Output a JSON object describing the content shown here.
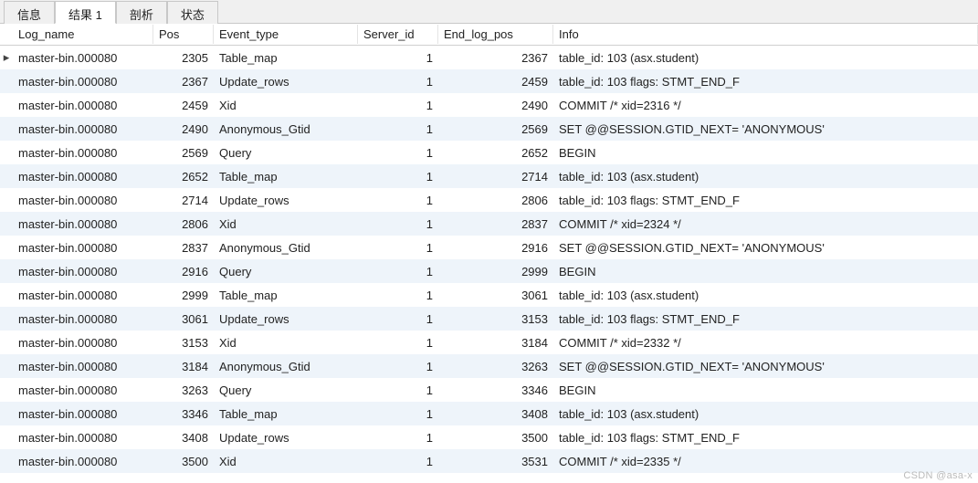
{
  "tabs": {
    "info": "信息",
    "result1": "结果 1",
    "profile": "剖析",
    "status": "状态"
  },
  "columns": {
    "log_name": "Log_name",
    "pos": "Pos",
    "event_type": "Event_type",
    "server_id": "Server_id",
    "end_log_pos": "End_log_pos",
    "info": "Info"
  },
  "rows": [
    {
      "marker": "▸",
      "log_name": "master-bin.000080",
      "pos": "2305",
      "event_type": "Table_map",
      "server_id": "1",
      "end_log_pos": "2367",
      "info": "table_id: 103 (asx.student)"
    },
    {
      "marker": "",
      "log_name": "master-bin.000080",
      "pos": "2367",
      "event_type": "Update_rows",
      "server_id": "1",
      "end_log_pos": "2459",
      "info": "table_id: 103 flags: STMT_END_F"
    },
    {
      "marker": "",
      "log_name": "master-bin.000080",
      "pos": "2459",
      "event_type": "Xid",
      "server_id": "1",
      "end_log_pos": "2490",
      "info": "COMMIT /* xid=2316 */"
    },
    {
      "marker": "",
      "log_name": "master-bin.000080",
      "pos": "2490",
      "event_type": "Anonymous_Gtid",
      "server_id": "1",
      "end_log_pos": "2569",
      "info": "SET @@SESSION.GTID_NEXT= 'ANONYMOUS'"
    },
    {
      "marker": "",
      "log_name": "master-bin.000080",
      "pos": "2569",
      "event_type": "Query",
      "server_id": "1",
      "end_log_pos": "2652",
      "info": "BEGIN"
    },
    {
      "marker": "",
      "log_name": "master-bin.000080",
      "pos": "2652",
      "event_type": "Table_map",
      "server_id": "1",
      "end_log_pos": "2714",
      "info": "table_id: 103 (asx.student)"
    },
    {
      "marker": "",
      "log_name": "master-bin.000080",
      "pos": "2714",
      "event_type": "Update_rows",
      "server_id": "1",
      "end_log_pos": "2806",
      "info": "table_id: 103 flags: STMT_END_F"
    },
    {
      "marker": "",
      "log_name": "master-bin.000080",
      "pos": "2806",
      "event_type": "Xid",
      "server_id": "1",
      "end_log_pos": "2837",
      "info": "COMMIT /* xid=2324 */"
    },
    {
      "marker": "",
      "log_name": "master-bin.000080",
      "pos": "2837",
      "event_type": "Anonymous_Gtid",
      "server_id": "1",
      "end_log_pos": "2916",
      "info": "SET @@SESSION.GTID_NEXT= 'ANONYMOUS'"
    },
    {
      "marker": "",
      "log_name": "master-bin.000080",
      "pos": "2916",
      "event_type": "Query",
      "server_id": "1",
      "end_log_pos": "2999",
      "info": "BEGIN"
    },
    {
      "marker": "",
      "log_name": "master-bin.000080",
      "pos": "2999",
      "event_type": "Table_map",
      "server_id": "1",
      "end_log_pos": "3061",
      "info": "table_id: 103 (asx.student)"
    },
    {
      "marker": "",
      "log_name": "master-bin.000080",
      "pos": "3061",
      "event_type": "Update_rows",
      "server_id": "1",
      "end_log_pos": "3153",
      "info": "table_id: 103 flags: STMT_END_F"
    },
    {
      "marker": "",
      "log_name": "master-bin.000080",
      "pos": "3153",
      "event_type": "Xid",
      "server_id": "1",
      "end_log_pos": "3184",
      "info": "COMMIT /* xid=2332 */"
    },
    {
      "marker": "",
      "log_name": "master-bin.000080",
      "pos": "3184",
      "event_type": "Anonymous_Gtid",
      "server_id": "1",
      "end_log_pos": "3263",
      "info": "SET @@SESSION.GTID_NEXT= 'ANONYMOUS'"
    },
    {
      "marker": "",
      "log_name": "master-bin.000080",
      "pos": "3263",
      "event_type": "Query",
      "server_id": "1",
      "end_log_pos": "3346",
      "info": "BEGIN"
    },
    {
      "marker": "",
      "log_name": "master-bin.000080",
      "pos": "3346",
      "event_type": "Table_map",
      "server_id": "1",
      "end_log_pos": "3408",
      "info": "table_id: 103 (asx.student)"
    },
    {
      "marker": "",
      "log_name": "master-bin.000080",
      "pos": "3408",
      "event_type": "Update_rows",
      "server_id": "1",
      "end_log_pos": "3500",
      "info": "table_id: 103 flags: STMT_END_F"
    },
    {
      "marker": "",
      "log_name": "master-bin.000080",
      "pos": "3500",
      "event_type": "Xid",
      "server_id": "1",
      "end_log_pos": "3531",
      "info": "COMMIT /* xid=2335 */"
    }
  ],
  "watermark": "CSDN @asa-x"
}
